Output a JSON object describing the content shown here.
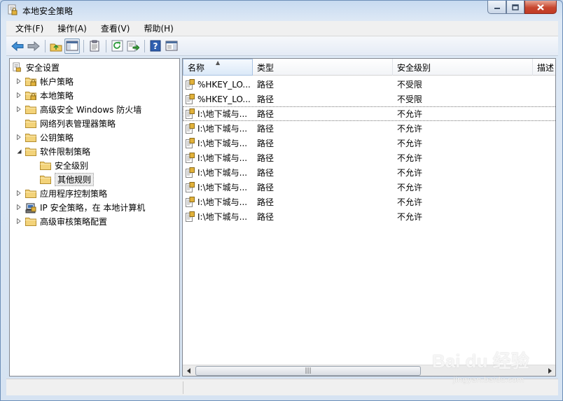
{
  "window": {
    "title": "本地安全策略"
  },
  "menu": [
    "文件(F)",
    "操作(A)",
    "查看(V)",
    "帮助(H)"
  ],
  "tree": {
    "root": "安全设置",
    "items": [
      {
        "label": "帐户策略",
        "expander": "collapsed",
        "icon": "lock-folder-icon"
      },
      {
        "label": "本地策略",
        "expander": "collapsed",
        "icon": "lock-folder-icon"
      },
      {
        "label": "高级安全 Windows 防火墙",
        "expander": "collapsed",
        "icon": "folder-icon"
      },
      {
        "label": "网络列表管理器策略",
        "expander": "none",
        "icon": "folder-icon"
      },
      {
        "label": "公钥策略",
        "expander": "collapsed",
        "icon": "folder-icon"
      },
      {
        "label": "软件限制策略",
        "expander": "expanded",
        "icon": "folder-icon"
      },
      {
        "label": "安全级别",
        "expander": "none",
        "icon": "folder-icon",
        "child": true
      },
      {
        "label": "其他规则",
        "expander": "none",
        "icon": "folder-icon",
        "child": true,
        "selected": true
      },
      {
        "label": "应用程序控制策略",
        "expander": "collapsed",
        "icon": "folder-icon"
      },
      {
        "label": "IP 安全策略，在 本地计算机",
        "expander": "collapsed",
        "icon": "ip-security-icon"
      },
      {
        "label": "高级审核策略配置",
        "expander": "collapsed",
        "icon": "folder-icon"
      }
    ]
  },
  "list": {
    "columns": [
      "名称",
      "类型",
      "安全级别",
      "描述"
    ],
    "rows": [
      {
        "name": "%HKEY_LO...",
        "type": "路径",
        "level": "不受限"
      },
      {
        "name": "%HKEY_LO...",
        "type": "路径",
        "level": "不受限"
      },
      {
        "name": "I:\\地下城与...",
        "type": "路径",
        "level": "不允许"
      },
      {
        "name": "I:\\地下城与...",
        "type": "路径",
        "level": "不允许"
      },
      {
        "name": "I:\\地下城与...",
        "type": "路径",
        "level": "不允许"
      },
      {
        "name": "I:\\地下城与...",
        "type": "路径",
        "level": "不允许"
      },
      {
        "name": "I:\\地下城与...",
        "type": "路径",
        "level": "不允许"
      },
      {
        "name": "I:\\地下城与...",
        "type": "路径",
        "level": "不允许"
      },
      {
        "name": "I:\\地下城与...",
        "type": "路径",
        "level": "不允许"
      },
      {
        "name": "I:\\地下城与...",
        "type": "路径",
        "level": "不允许"
      }
    ],
    "focused_row": 2
  },
  "scrollbar": {
    "grip": "|||"
  },
  "watermark": {
    "text": "Bai du 经验",
    "sub": "jingyan.baidu.com"
  },
  "colors": {
    "accent": "#3a6ea5",
    "close": "#c7462f",
    "folder": "#f3d37a"
  }
}
